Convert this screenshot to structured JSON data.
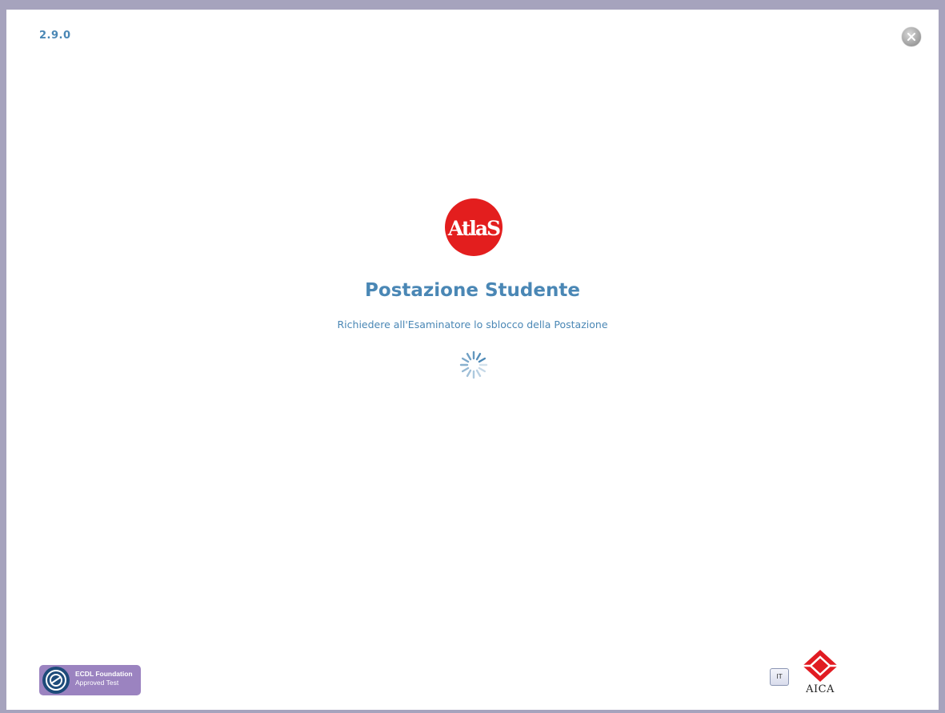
{
  "app": {
    "version": "2.9.0"
  },
  "main": {
    "logo_text": "AtlaS",
    "title": "Postazione Studente",
    "message": "Richiedere all'Esaminatore lo sblocco della Postazione"
  },
  "footer": {
    "ecdl_line1": "ECDL Foundation",
    "ecdl_line2": "Approved Test",
    "language_label": "IT",
    "aica_label": "AICA"
  },
  "colors": {
    "accent": "#4a87b5",
    "border": "#a6a3bd",
    "logo_red": "#e31e1e",
    "ecdl_purple": "#9b83c0",
    "aica_red": "#e11b22"
  },
  "icons": {
    "close": "close-icon",
    "spinner": "loading-spinner-icon"
  }
}
